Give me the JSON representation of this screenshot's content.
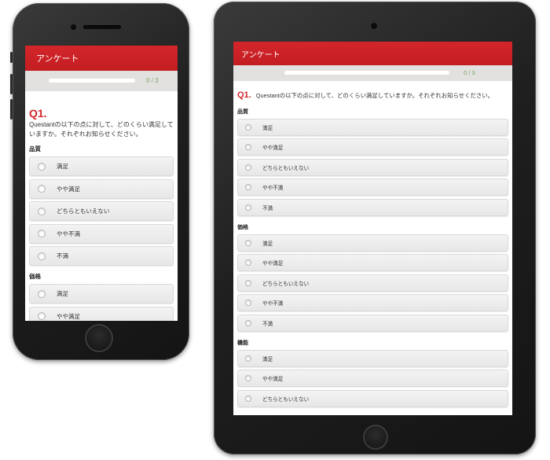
{
  "survey": {
    "title": "アンケート",
    "progress_text": "0 / 3",
    "progress_fraction": 0,
    "question": {
      "number": "Q1.",
      "text": "Questantの以下の点に対して、どのくらい満足していますか。それぞれお知らせください。"
    },
    "sections": [
      {
        "label": "品質",
        "options": [
          "満足",
          "やや満足",
          "どちらともいえない",
          "やや不満",
          "不満"
        ]
      },
      {
        "label": "価格",
        "options": [
          "満足",
          "やや満足",
          "どちらともいえない",
          "やや不満",
          "不満"
        ]
      },
      {
        "label": "機能",
        "options": [
          "満足",
          "やや満足",
          "どちらともいえない"
        ]
      }
    ]
  },
  "colors": {
    "header_red": "#d3262b",
    "progress_green": "#7aa35f",
    "progress_bg": "#e3e1df"
  }
}
